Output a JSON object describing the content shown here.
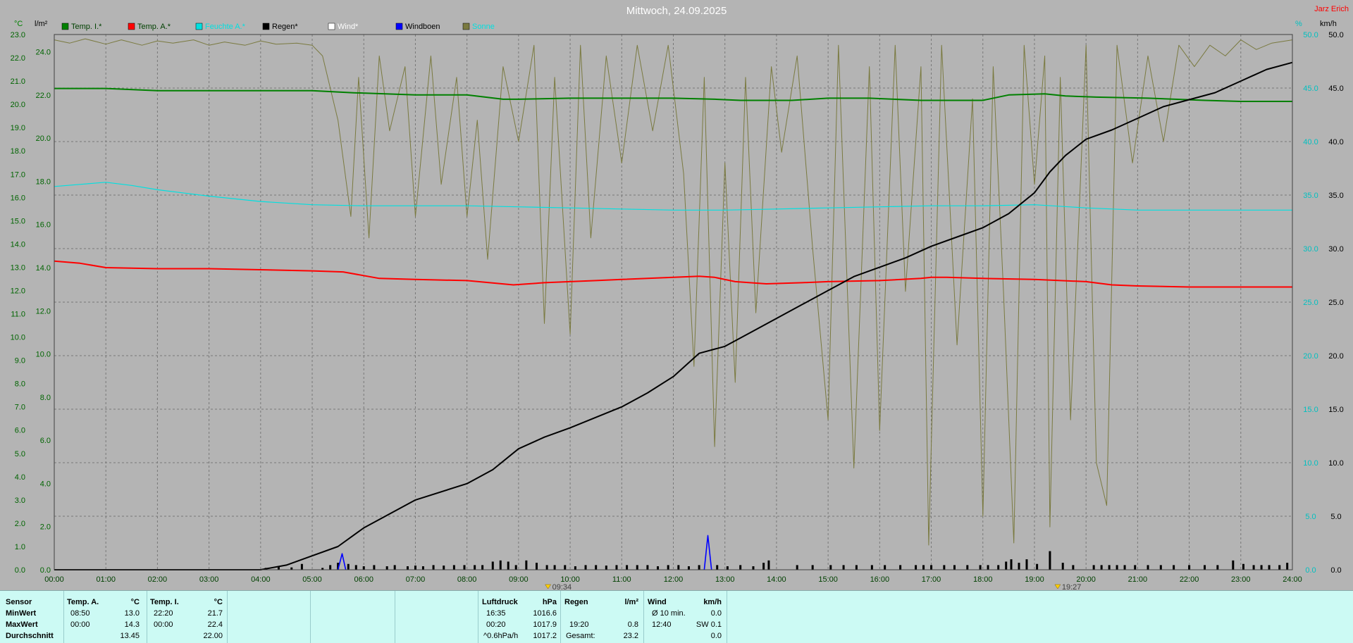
{
  "header": {
    "title": "Mittwoch, 24.09.2025",
    "author": "Jarz Erich",
    "left_units": "°C",
    "rain_unit": "l/m²",
    "right_units": "%",
    "right_speed_unit": "km/h"
  },
  "colors": {
    "background": "#b4b4b4",
    "plot_background": "#b4b4b4",
    "temp_in": "#008000",
    "temp_out": "#ff0000",
    "humidity": "#00e0e0",
    "rain": "#000000",
    "wind": "#ffffff",
    "gust": "#0000ff",
    "solar": "#7a7a40",
    "axis_left": "#006400",
    "axis_right": "#00c0c0",
    "title": "#ffffff",
    "author": "#ff0000",
    "panel": "#ccfaf4"
  },
  "legend": [
    {
      "label": "Temp. I.*",
      "color": "#008000",
      "text_color": "#004000"
    },
    {
      "label": "Temp. A.*",
      "color": "#ff0000",
      "text_color": "#004000"
    },
    {
      "label": "Feuchte A.*",
      "color": "#00e0e0",
      "text_color": "#00e0e0"
    },
    {
      "label": "Regen*",
      "color": "#000000",
      "text_color": "#000000"
    },
    {
      "label": "Wind*",
      "color": "#ffffff",
      "text_color": "#ffffff"
    },
    {
      "label": "Windboen",
      "color": "#0000ff",
      "text_color": "#000000"
    },
    {
      "label": "Sonne",
      "color": "#7a7a40",
      "text_color": "#00e0e0"
    }
  ],
  "chart_data": {
    "type": "line",
    "title": "Mittwoch, 24.09.2025",
    "x_ticks": [
      "00:00",
      "01:00",
      "02:00",
      "03:00",
      "04:00",
      "05:00",
      "06:00",
      "07:00",
      "08:00",
      "09:00",
      "10:00",
      "11:00",
      "12:00",
      "13:00",
      "14:00",
      "15:00",
      "16:00",
      "17:00",
      "18:00",
      "19:00",
      "20:00",
      "21:00",
      "22:00",
      "23:00",
      "24:00"
    ],
    "x_range_hours": [
      0,
      24
    ],
    "rain_axis": {
      "unit": "l/m²",
      "range": [
        0,
        23
      ],
      "ticks": [
        "0.0",
        "1.0",
        "2.0",
        "3.0",
        "4.0",
        "5.0",
        "6.0",
        "7.0",
        "8.0",
        "9.0",
        "10.0",
        "11.0",
        "12.0",
        "13.0",
        "14.0",
        "15.0",
        "16.0",
        "17.0",
        "18.0",
        "19.0",
        "20.0",
        "21.0",
        "22.0",
        "23.0"
      ]
    },
    "temp_axis": {
      "unit": "°C",
      "range": [
        0,
        24.8
      ],
      "ticks": [
        "0.0",
        "2.0",
        "4.0",
        "6.0",
        "8.0",
        "10.0",
        "12.0",
        "14.0",
        "16.0",
        "18.0",
        "20.0",
        "22.0",
        "24.0"
      ]
    },
    "right_axis": {
      "unit": "km/h",
      "range": [
        0,
        50
      ],
      "ticks": [
        "0.0",
        "5.0",
        "10.0",
        "15.0",
        "20.0",
        "25.0",
        "30.0",
        "35.0",
        "40.0",
        "45.0",
        "50.0"
      ]
    },
    "markers": [
      {
        "time": "09:34",
        "hour": 9.57
      },
      {
        "time": "19:27",
        "hour": 19.45
      }
    ],
    "grid": true,
    "series": [
      {
        "name": "Temp. I.*",
        "axis": "temp",
        "color": "#008000",
        "hours": [
          0,
          1,
          2,
          3,
          4,
          5,
          5.8,
          7,
          8,
          8.7,
          9,
          10,
          11,
          12,
          12.8,
          13.3,
          14.3,
          15,
          15.8,
          16.8,
          18,
          18.5,
          19.2,
          19.6,
          20.2,
          21.2,
          22.3,
          23,
          24
        ],
        "values": [
          22.3,
          22.3,
          22.2,
          22.2,
          22.2,
          22.2,
          22.1,
          22.0,
          22.0,
          21.8,
          21.8,
          21.85,
          21.85,
          21.85,
          21.8,
          21.75,
          21.75,
          21.85,
          21.85,
          21.75,
          21.75,
          22.0,
          22.05,
          21.95,
          21.9,
          21.85,
          21.75,
          21.7,
          21.7
        ]
      },
      {
        "name": "Temp. A.*",
        "axis": "temp",
        "color": "#ff0000",
        "hours": [
          0,
          0.5,
          1,
          2,
          3,
          4,
          5,
          5.6,
          6.3,
          7,
          8,
          8.9,
          9.5,
          10.5,
          11,
          12,
          12.5,
          12.8,
          13.2,
          13.8,
          14.5,
          15,
          16,
          16.8,
          17,
          17.3,
          18,
          19,
          20,
          20.5,
          21,
          22,
          23,
          24
        ],
        "values": [
          14.3,
          14.2,
          14.0,
          13.95,
          13.95,
          13.9,
          13.85,
          13.8,
          13.5,
          13.45,
          13.4,
          13.2,
          13.3,
          13.4,
          13.45,
          13.55,
          13.6,
          13.55,
          13.35,
          13.25,
          13.3,
          13.35,
          13.4,
          13.5,
          13.55,
          13.55,
          13.5,
          13.45,
          13.35,
          13.2,
          13.15,
          13.1,
          13.1,
          13.1
        ]
      },
      {
        "name": "Feuchte A.*",
        "axis": "right",
        "color": "#00e0e0",
        "hours": [
          0,
          0.5,
          1,
          1.5,
          2,
          3,
          4,
          5,
          6,
          7,
          8,
          9,
          10,
          11,
          12,
          13,
          14,
          15,
          16,
          17,
          18,
          19,
          20,
          21,
          22,
          23,
          24
        ],
        "values": [
          35.8,
          36.0,
          36.2,
          35.9,
          35.5,
          34.9,
          34.4,
          34.1,
          34.0,
          34.0,
          34.0,
          33.9,
          33.8,
          33.7,
          33.6,
          33.6,
          33.7,
          33.8,
          33.9,
          34.0,
          34.0,
          34.1,
          33.8,
          33.6,
          33.6,
          33.6,
          33.6
        ]
      },
      {
        "name": "Regen*",
        "axis": "rain",
        "color": "#000000",
        "hours": [
          0,
          4,
          4.5,
          5,
          5.5,
          6,
          7,
          8,
          8.5,
          9,
          9.5,
          10,
          11,
          11.5,
          12,
          12.5,
          13,
          13.5,
          14,
          14.5,
          15,
          15.5,
          16,
          16.5,
          17,
          17.5,
          18,
          18.5,
          19,
          19.3,
          19.6,
          20,
          20.5,
          21,
          21.5,
          22,
          22.5,
          23,
          23.5,
          24
        ],
        "values": [
          0,
          0,
          0.2,
          0.6,
          1.0,
          1.8,
          3.0,
          3.7,
          4.3,
          5.2,
          5.7,
          6.1,
          7.0,
          7.6,
          8.3,
          9.3,
          9.6,
          10.2,
          10.8,
          11.4,
          12.0,
          12.6,
          13.0,
          13.4,
          13.9,
          14.3,
          14.7,
          15.3,
          16.2,
          17.1,
          17.8,
          18.5,
          18.9,
          19.4,
          19.9,
          20.2,
          20.5,
          21.0,
          21.5,
          21.8
        ]
      },
      {
        "name": "Windboen",
        "axis": "right",
        "color": "#0000ff",
        "hours": [
          5.5,
          5.58,
          5.65,
          12.6,
          12.67,
          12.74
        ],
        "values": [
          0,
          1.5,
          0,
          0,
          3.2,
          0
        ],
        "segments": [
          [
            0,
            2
          ],
          [
            3,
            5
          ]
        ]
      },
      {
        "name": "Sonne",
        "axis": "right",
        "color": "#7a7a40",
        "hours": [
          0,
          0.3,
          0.6,
          1,
          1.3,
          1.7,
          2,
          2.3,
          2.7,
          3,
          3.3,
          3.7,
          4,
          4.3,
          4.7,
          5,
          5.2,
          5.5,
          5.75,
          5.9,
          6.1,
          6.3,
          6.5,
          6.8,
          7.0,
          7.3,
          7.5,
          7.8,
          8.0,
          8.2,
          8.4,
          8.7,
          9.0,
          9.3,
          9.5,
          9.7,
          10.0,
          10.2,
          10.4,
          10.7,
          11.0,
          11.3,
          11.6,
          11.9,
          12.2,
          12.4,
          12.6,
          12.8,
          13.0,
          13.2,
          13.4,
          13.6,
          13.9,
          14.1,
          14.4,
          14.7,
          15.0,
          15.2,
          15.5,
          15.8,
          16.0,
          16.3,
          16.5,
          16.8,
          16.95,
          17.2,
          17.5,
          17.8,
          18.0,
          18.2,
          18.4,
          18.6,
          18.8,
          19.0,
          19.2,
          19.3,
          19.5,
          19.7,
          20.0,
          20.2,
          20.4,
          20.6,
          20.9,
          21.2,
          21.5,
          21.8,
          22.1,
          22.4,
          22.7,
          23.0,
          23.3,
          23.6,
          24.0
        ],
        "values": [
          49.5,
          49.2,
          49.6,
          49.1,
          49.5,
          49.0,
          49.4,
          49.2,
          49.5,
          49.0,
          49.3,
          49.0,
          49.4,
          49.1,
          49.2,
          49.0,
          48.0,
          42.0,
          33.0,
          46.0,
          31.0,
          48.0,
          41.0,
          47.0,
          33.0,
          48.0,
          36.0,
          46.0,
          33.0,
          42.0,
          29.0,
          47.0,
          40.0,
          49.0,
          23.0,
          46.0,
          22.0,
          49.0,
          31.0,
          48.0,
          38.0,
          49.0,
          41.0,
          49.0,
          37.0,
          19.0,
          46.0,
          11.5,
          38.0,
          17.5,
          46.0,
          24.0,
          47.0,
          39.0,
          48.0,
          30.0,
          14.0,
          49.0,
          9.5,
          47.0,
          13.0,
          49.0,
          26.0,
          47.0,
          2.3,
          49.0,
          21.0,
          44.0,
          5.0,
          47.0,
          26.0,
          2.5,
          49.0,
          36.0,
          48.0,
          4.0,
          46.0,
          14.0,
          49.0,
          10.0,
          6.0,
          49.0,
          38.0,
          48.0,
          40.0,
          49.0,
          47.0,
          49.0,
          48.0,
          49.5,
          48.6,
          49.2,
          49.5
        ]
      }
    ]
  },
  "rain_bars": {
    "hours": [
      4.1,
      4.35,
      4.6,
      4.8,
      5.2,
      5.35,
      5.5,
      5.7,
      5.85,
      6.0,
      6.2,
      6.45,
      6.6,
      6.85,
      7.0,
      7.15,
      7.35,
      7.55,
      7.75,
      7.95,
      8.15,
      8.3,
      8.5,
      8.65,
      8.8,
      8.95,
      9.15,
      9.35,
      9.55,
      9.7,
      9.9,
      10.1,
      10.3,
      10.5,
      10.7,
      10.9,
      11.1,
      11.3,
      11.5,
      11.7,
      11.9,
      12.1,
      12.3,
      12.5,
      12.85,
      13.05,
      13.3,
      13.55,
      13.75,
      13.85,
      14.4,
      14.7,
      15.05,
      15.3,
      15.55,
      15.85,
      16.1,
      16.4,
      16.7,
      16.85,
      17.0,
      17.25,
      17.45,
      17.7,
      17.95,
      18.1,
      18.3,
      18.45,
      18.55,
      18.7,
      18.85,
      19.05,
      19.3,
      19.55,
      19.75,
      20.15,
      20.3,
      20.45,
      20.6,
      20.75,
      20.95,
      21.2,
      21.45,
      21.7,
      22.0,
      22.3,
      22.55,
      22.85,
      23.05,
      23.25,
      23.4,
      23.55,
      23.75,
      23.9
    ],
    "values": [
      0.08,
      0.12,
      0.1,
      0.25,
      0.08,
      0.2,
      0.3,
      0.25,
      0.2,
      0.15,
      0.2,
      0.15,
      0.2,
      0.15,
      0.18,
      0.15,
      0.2,
      0.18,
      0.2,
      0.2,
      0.2,
      0.2,
      0.35,
      0.4,
      0.35,
      0.2,
      0.4,
      0.3,
      0.2,
      0.2,
      0.2,
      0.15,
      0.2,
      0.2,
      0.18,
      0.2,
      0.2,
      0.2,
      0.2,
      0.15,
      0.2,
      0.2,
      0.15,
      0.2,
      0.2,
      0.15,
      0.2,
      0.15,
      0.3,
      0.4,
      0.2,
      0.2,
      0.2,
      0.2,
      0.2,
      0.2,
      0.2,
      0.2,
      0.2,
      0.2,
      0.2,
      0.2,
      0.2,
      0.2,
      0.2,
      0.2,
      0.2,
      0.35,
      0.45,
      0.3,
      0.45,
      0.25,
      0.8,
      0.3,
      0.2,
      0.2,
      0.2,
      0.2,
      0.2,
      0.2,
      0.2,
      0.2,
      0.2,
      0.2,
      0.2,
      0.2,
      0.2,
      0.4,
      0.25,
      0.2,
      0.2,
      0.2,
      0.2,
      0.3
    ]
  },
  "summary": {
    "sensor": {
      "title": "Sensor",
      "rows": [
        "MinWert",
        "MaxWert",
        "Durchschnitt"
      ]
    },
    "temp_out": {
      "title": "Temp. A.",
      "unit": "°C",
      "rows": [
        {
          "time": "08:50",
          "value": "13.0"
        },
        {
          "time": "00:00",
          "value": "14.3"
        },
        {
          "time": "",
          "value": "13.45"
        }
      ]
    },
    "temp_in": {
      "title": "Temp. I.",
      "unit": "°C",
      "rows": [
        {
          "time": "22:20",
          "value": "21.7"
        },
        {
          "time": "00:00",
          "value": "22.4"
        },
        {
          "time": "",
          "value": "22.00"
        }
      ]
    },
    "pressure": {
      "title": "Luftdruck",
      "unit": "hPa",
      "rows": [
        {
          "time": "16:35",
          "value": "1016.6"
        },
        {
          "time": "00:20",
          "value": "1017.9"
        },
        {
          "time": "^0.6hPa/h",
          "value": "1017.2"
        }
      ]
    },
    "rain": {
      "title": "Regen",
      "unit": "l/m²",
      "rows": [
        {
          "time": "",
          "value": ""
        },
        {
          "time": "19:20",
          "value": "0.8"
        },
        {
          "time": "Gesamt:",
          "value": "23.2"
        }
      ]
    },
    "wind": {
      "title": "Wind",
      "unit": "km/h",
      "rows": [
        {
          "time": "Ø 10 min.",
          "value": "0.0"
        },
        {
          "time": "12:40",
          "value": "SW 0.1"
        },
        {
          "time": "",
          "value": "0.0"
        }
      ]
    }
  }
}
